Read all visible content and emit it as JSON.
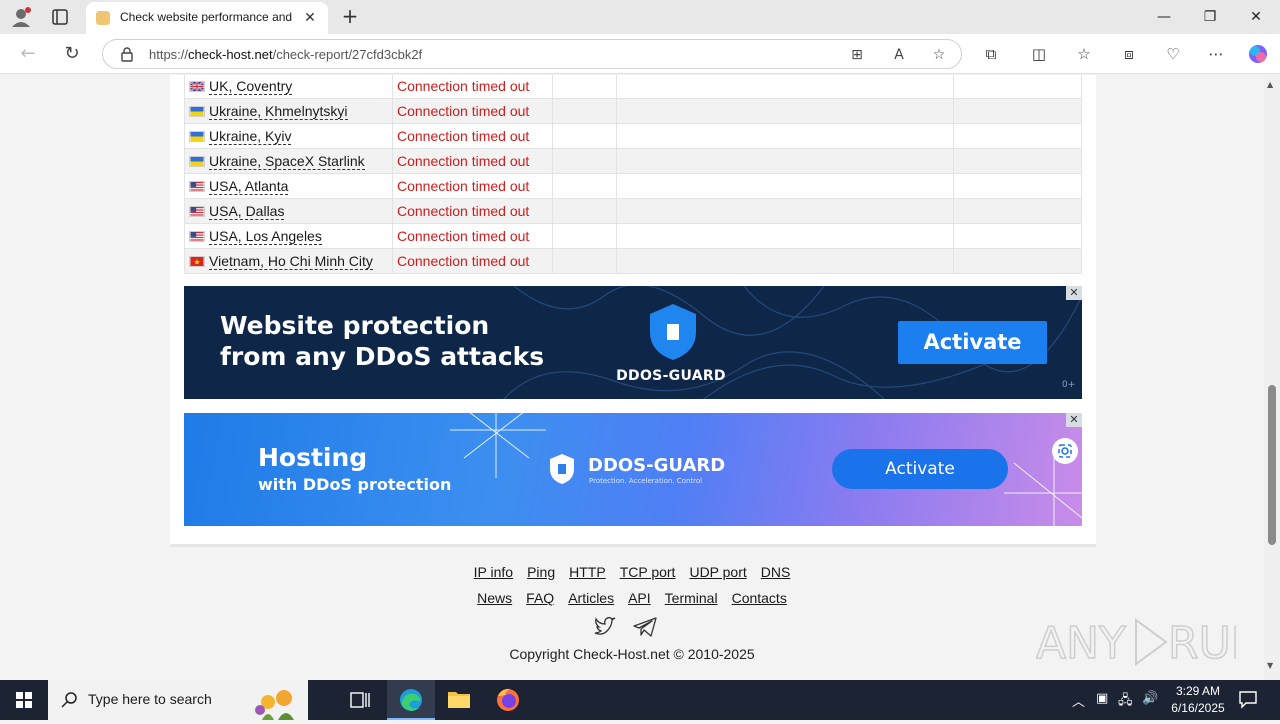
{
  "browser": {
    "tab_title": "Check website performance and r",
    "url_prefix": "https://",
    "url_host": "check-host.net",
    "url_path": "/check-report/27cfd3cbk2f"
  },
  "results": [
    {
      "flag": "uk",
      "location": "UK, Coventry",
      "status": "Connection timed out"
    },
    {
      "flag": "ua",
      "location": "Ukraine, Khmelnytskyi",
      "status": "Connection timed out"
    },
    {
      "flag": "ua",
      "location": "Ukraine, Kyiv",
      "status": "Connection timed out"
    },
    {
      "flag": "ua",
      "location": "Ukraine, SpaceX Starlink",
      "status": "Connection timed out"
    },
    {
      "flag": "us",
      "location": "USA, Atlanta",
      "status": "Connection timed out"
    },
    {
      "flag": "us",
      "location": "USA, Dallas",
      "status": "Connection timed out"
    },
    {
      "flag": "us",
      "location": "USA, Los Angeles",
      "status": "Connection timed out"
    },
    {
      "flag": "vn",
      "location": "Vietnam, Ho Chi Minh City",
      "status": "Connection timed out"
    }
  ],
  "ad1": {
    "title_line1": "Website protection",
    "title_line2": "from any DDoS attacks",
    "brand": "DDOS-GUARD",
    "button": "Activate",
    "age": "0+"
  },
  "ad2": {
    "title": "Hosting",
    "subtitle": "with DDoS protection",
    "brand": "DDOS-GUARD",
    "tagline": "Protection. Acceleration. Control",
    "button": "Activate"
  },
  "footer": {
    "links_row1": [
      "IP info",
      "Ping",
      "HTTP",
      "TCP port",
      "UDP port",
      "DNS"
    ],
    "links_row2": [
      "News",
      "FAQ",
      "Articles",
      "API",
      "Terminal",
      "Contacts"
    ],
    "social_icons": [
      "twitter-icon",
      "telegram-icon"
    ],
    "copyright": "Copyright Check-Host.net © 2010-2025"
  },
  "scrollbar": {
    "position_fraction": 0.72
  },
  "taskbar": {
    "search_placeholder": "Type here to search",
    "time": "3:29 AM",
    "date": "6/16/2025"
  },
  "colors": {
    "error_text": "#d01c1c",
    "ad1_bg": "#0e2748",
    "ad_button": "#1b7ff0",
    "taskbar_bg": "#1c2433"
  }
}
